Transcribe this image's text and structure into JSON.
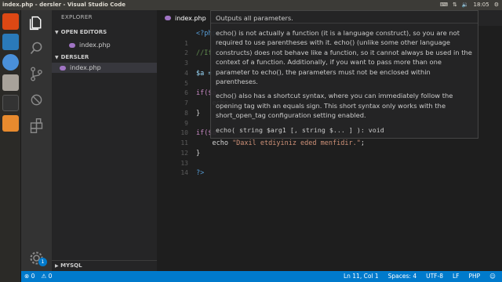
{
  "window": {
    "title": "index.php - dersler - Visual Studio Code"
  },
  "system_tray": {
    "clock": "18:05"
  },
  "sidebar": {
    "title": "EXPLORER",
    "open_editors_label": "OPEN EDITORS",
    "open_editors": [
      {
        "name": "index.php"
      }
    ],
    "folder_label": "DERSLER",
    "files": [
      {
        "name": "index.php"
      }
    ],
    "mysql_label": "MYSQL"
  },
  "tab": {
    "name": "index.php",
    "close": "×"
  },
  "code": {
    "line_numbers": [
      "1",
      "2",
      "3",
      "4",
      "5",
      "6",
      "7",
      "8",
      "9",
      "10",
      "11",
      "12",
      "13",
      "14"
    ],
    "lines": [
      {
        "t": "<?php",
        "c": "kw"
      },
      {
        "t": "",
        "c": "pl"
      },
      {
        "t": "//If",
        "c": "cm"
      },
      {
        "t": "",
        "c": "pl"
      },
      {
        "t": "$a = ",
        "c": "vr"
      },
      {
        "t": "",
        "c": "pl"
      },
      {
        "t": "if($a",
        "c": "ctl"
      },
      {
        "t": "    echo",
        "c": "pl"
      },
      {
        "t": "}",
        "c": "pl"
      },
      {
        "t": "",
        "c": "pl"
      },
      {
        "t": "if($a",
        "c": "ctl"
      },
      {
        "t": "    echo \"Daxil etdiyiniz eded menfidir.\";",
        "c": "mix"
      },
      {
        "t": "}",
        "c": "pl"
      },
      {
        "t": "",
        "c": "pl"
      },
      {
        "t": "?>",
        "c": "kw"
      }
    ]
  },
  "hover": {
    "title": "Outputs all parameters.",
    "paragraph1": "echo() is not actually a function (it is a language construct), so you are not required to use parentheses with it. echo() (unlike some other language constructs) does not behave like a function, so it cannot always be used in the context of a function. Additionally, if you want to pass more than one parameter to echo(), the parameters must not be enclosed within parentheses.",
    "paragraph2": "echo() also has a shortcut syntax, where you can immediately follow the opening tag with an equals sign. This short syntax only works with the short_open_tag configuration setting enabled.",
    "signature": "echo( string $arg1 [, string $... ] ): void"
  },
  "status": {
    "errors": "0",
    "warnings": "0",
    "position": "Ln 11, Col 1",
    "spaces": "Spaces: 4",
    "encoding": "UTF-8",
    "eol": "LF",
    "language": "PHP",
    "notification_count": "1"
  },
  "colors": {
    "accent": "#007acc",
    "php": "#a074c4"
  }
}
